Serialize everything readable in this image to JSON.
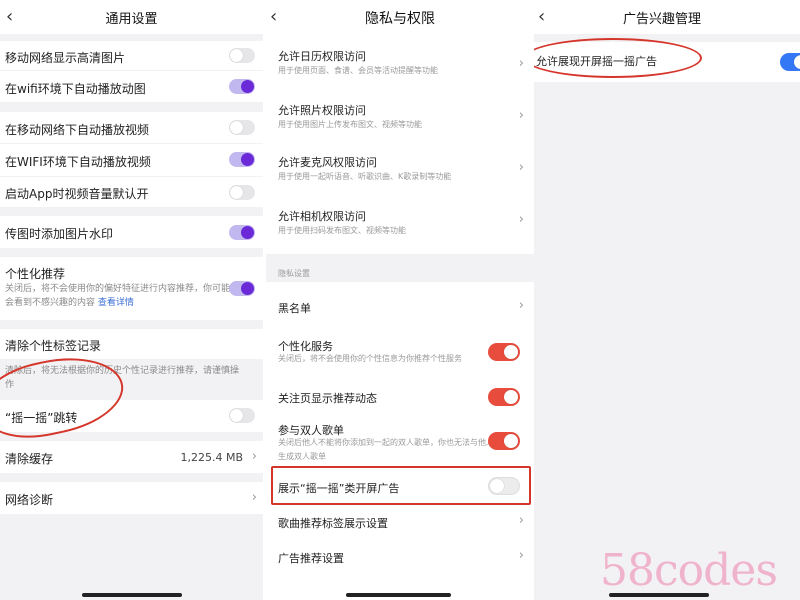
{
  "panel1": {
    "title": "通用设置",
    "back": "‹",
    "rows": [
      {
        "label": "移动网络显示高清图片"
      },
      {
        "label": "在wifi环境下自动播放动图"
      },
      {
        "label": "在移动网络下自动播放视频"
      },
      {
        "label": "在WIFI环境下自动播放视频"
      },
      {
        "label": "启动App时视频音量默认开"
      },
      {
        "label": "传图时添加图片水印"
      },
      {
        "label": "个性化推荐",
        "desc": "关闭后，将不会使用你的偏好特征进行内容推荐，你可能会看到不感兴趣的内容",
        "link": "查看详情"
      },
      {
        "label": "清除个性标签记录",
        "desc": "清除后，将无法根据你的历史个性记录进行推荐，请谨慎操作"
      },
      {
        "label": "“摇一摇”跳转"
      },
      {
        "label": "清除缓存",
        "value": "1,225.4 MB"
      },
      {
        "label": "网络诊断"
      }
    ]
  },
  "panel2": {
    "title": "隐私与权限",
    "back": "‹",
    "rows": [
      {
        "label": "允许日历权限访问",
        "desc": "用于使用页面、食谱、会员等活动提醒等功能"
      },
      {
        "label": "允许照片权限访问",
        "desc": "用于使用图片上传发布图文、视频等功能"
      },
      {
        "label": "允许麦克风权限访问",
        "desc": "用于使用一起听语音、听歌识曲、K歌录制等功能"
      },
      {
        "label": "允许相机权限访问",
        "desc": "用于使用扫码发布图文、视频等功能"
      }
    ],
    "section_caption": "隐私设置",
    "rows2": [
      {
        "label": "黑名单"
      },
      {
        "label": "个性化服务",
        "desc": "关闭后，将不会使用你的个性信息为你推荐个性服务"
      },
      {
        "label": "关注页显示推荐动态"
      },
      {
        "label": "参与双人歌单",
        "desc": "关闭后他人不能将你添加到一起的双人歌单，你也无法与他人生成双人歌单"
      },
      {
        "label": "展示“摇一摇”类开屏广告"
      },
      {
        "label": "歌曲推荐标签展示设置"
      },
      {
        "label": "广告推荐设置"
      }
    ]
  },
  "panel3": {
    "title": "广告兴趣管理",
    "back": "‹",
    "rows": [
      {
        "label": "允许展现开屏摇一摇广告"
      }
    ]
  },
  "icons": {
    "chevron": "›"
  },
  "watermark": "58codes",
  "colors": {
    "purple_toggle": "#6a2ad8",
    "red_toggle": "#e74c3c",
    "blue_toggle": "#3478f6",
    "annotation_red": "#d5362b"
  },
  "toggle_states": {
    "p1": [
      false,
      true,
      false,
      true,
      false,
      true,
      true,
      false
    ],
    "p2": [
      true,
      true,
      true,
      false
    ],
    "p3": [
      true
    ]
  }
}
